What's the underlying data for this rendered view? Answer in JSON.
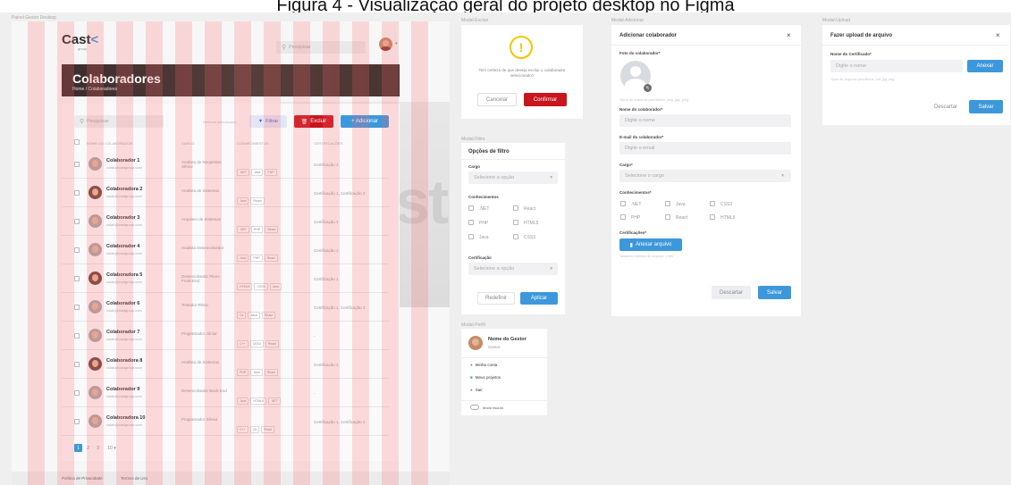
{
  "figure_title": "Figura 4 - Visualização geral do projeto desktop no Figma",
  "frame_labels": {
    "main": "Painel Gestor Desktop",
    "excluir": "Modal-Excluir",
    "adicionar": "Modal-Adicionar",
    "upload": "Modal-Upload",
    "filtro": "Modal-Filtro",
    "perfil": "Modal-Perfil"
  },
  "colors": {
    "accent_red": "#c9151e",
    "accent_blue": "#3d98db",
    "header_dark": "#3b2c2c",
    "warning": "#f5c400"
  },
  "main": {
    "logo": "Cast",
    "logo_sub": "group",
    "search_placeholder": "Pesquisar",
    "page_title": "Colaboradores",
    "breadcrumb": "Home / Colaboradores",
    "list_search_placeholder": "Pesquisar",
    "selected_text": "Nenhum selecionado",
    "filter_label": "Filtrar",
    "delete_label": "Excluir",
    "add_label": "+  Adicionar",
    "columns": [
      "NOME DO COLABORADOR",
      "CARGO",
      "CONHECIMENTOS",
      "CERTIFICAÇÕES"
    ],
    "rows": [
      {
        "name": "Colaborador 1",
        "email": "colab@castgroup.com",
        "role": "Analista de Requisitos Sênior",
        "skills": [
          ".NET",
          "Java",
          "PHP"
        ],
        "certs": "Certificação 1",
        "gender": "m"
      },
      {
        "name": "Colaboradora 2",
        "email": "colab@castgroup.com",
        "role": "Analista de Sistemas",
        "skills": [
          "Java",
          "React"
        ],
        "certs": "Certificação 1, Certificação 2",
        "gender": "f"
      },
      {
        "name": "Colaborador 3",
        "email": "colab@castgroup.com",
        "role": "Arquiteto de Sistemas",
        "skills": [
          ".NET",
          "PHP",
          "React"
        ],
        "certs": "Certificação 1",
        "gender": "m"
      },
      {
        "name": "Colaborador 4",
        "email": "colab@castgroup.com",
        "role": "Analista Desenvolvedor",
        "skills": [
          "Java",
          "PHP",
          "React"
        ],
        "certs": "Certificação 1",
        "gender": "m"
      },
      {
        "name": "Colaboradora 5",
        "email": "colab@castgroup.com",
        "role": "Desenvolvedor Pleno Front-End",
        "skills": [
          "HTML5",
          "CSS3",
          "Java"
        ],
        "certs": "Certificação 1",
        "gender": "f"
      },
      {
        "name": "Colaborador 6",
        "email": "colab@castgroup.com",
        "role": "Testador Pleno",
        "skills": [
          "C#",
          "Java",
          "React"
        ],
        "certs": "Certificação 1, Certificação 2",
        "gender": "m"
      },
      {
        "name": "Colaborador 7",
        "email": "colab@castgroup.com",
        "role": "Programador Júnior",
        "skills": [
          "C++",
          "CSS3",
          "React"
        ],
        "certs": "-",
        "gender": "m"
      },
      {
        "name": "Colaboradora 8",
        "email": "colab@castgroup.com",
        "role": "Analista de Sistemas",
        "skills": [
          "PHP",
          "Java",
          "React"
        ],
        "certs": "Certificação 1",
        "gender": "f"
      },
      {
        "name": "Colaborador 9",
        "email": "colab@castgroup.com",
        "role": "Desenvolvedor Back-End",
        "skills": [
          "Java",
          "HTML5",
          ".NET"
        ],
        "certs": "-",
        "gender": "m"
      },
      {
        "name": "Colaboradora 10",
        "email": "colab@castgroup.com",
        "role": "Programador Sênior",
        "skills": [
          "C++",
          "C#",
          "React"
        ],
        "certs": "Certificação 1, Certificação 2",
        "gender": "m"
      }
    ],
    "pages": [
      "1",
      "2",
      "3"
    ],
    "page_size": "10 ▾",
    "footer_privacy": "Política de Privacidade",
    "footer_terms": "Termos de Uso"
  },
  "excluir": {
    "icon": "!",
    "message": "Tem certeza de que deseja excluir o colaborador selecionado?",
    "cancel": "Cancelar",
    "confirm": "Confirmar"
  },
  "filtro": {
    "title": "Opções de filtro",
    "cargo_label": "Cargo",
    "cargo_placeholder": "Selecione a opção",
    "conhecimentos_label": "Conhecimentos",
    "options": [
      ".NET",
      "React",
      "PHP",
      "HTML5",
      "Java",
      "CSS3"
    ],
    "cert_label": "Certificação",
    "cert_placeholder": "Selecione a opção",
    "reset": "Redefinir",
    "apply": "Aplicar"
  },
  "perfil": {
    "name": "Nome do Gestor",
    "role": "Gestor",
    "menu": [
      "Minha conta",
      "Meus projetos",
      "Sair"
    ],
    "dark_mode": "Modo escuro"
  },
  "adicionar": {
    "title": "Adicionar colaborador",
    "close": "×",
    "photo_label": "Foto do colaborador*",
    "photo_hint": "Tipos de arquivos permitidos: png, jpg, jpeg",
    "name_label": "Nome do colaborador*",
    "name_placeholder": "Digite o nome",
    "email_label": "E-mail do colaborador*",
    "email_placeholder": "Digite o email",
    "cargo_label": "Cargo*",
    "cargo_placeholder": "Selecione o cargo",
    "conhecimentos_label": "Conhecimentos*",
    "options": [
      ".NET",
      "Java",
      "CSS3",
      "PHP",
      "React",
      "HTML5"
    ],
    "cert_label": "Certificações*",
    "attach": "Anexar arquivo",
    "attach_hint": "Tamanho máximo de arquivo: 1 MB",
    "discard": "Descartar",
    "save": "Salvar"
  },
  "upload": {
    "title": "Fazer upload de arquivo",
    "close": "×",
    "cert_label": "Nome do Certificado*",
    "cert_placeholder": "Digite o nome",
    "attach": "Anexar",
    "hint": "Tipos de arquivos permitidos: pdf, jpg, png",
    "discard": "Descartar",
    "save": "Salvar"
  }
}
